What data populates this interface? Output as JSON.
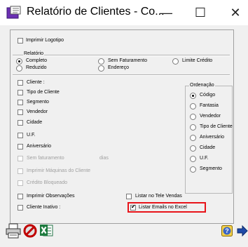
{
  "window": {
    "title": "Relatório de Clientes - Co...",
    "minimize": "—",
    "maximize": "☐",
    "close": "✕"
  },
  "options": {
    "imprimir_logotipo": "Imprimir Logotipo"
  },
  "relatorio": {
    "legend": "Relatório",
    "completo": "Completo",
    "reduzido": "Reduzido",
    "sem_faturamento": "Sem Faturamento",
    "endereco": "Endereço",
    "limite_credito": "Limite Crédito"
  },
  "filters": {
    "cliente": "Cliente :",
    "tipo_cliente": "Tipo de Cliente",
    "segmento": "Segmento",
    "vendedor": "Vendedor",
    "cidade": "Cidade",
    "uf": "U.F.",
    "aniversario": "Aniversário",
    "sem_faturamento": "Sem faturamento",
    "dias": "dias",
    "imprimir_maquinas": "Imprimir Máquinas do Cliente",
    "credito_bloqueado": "Crédito Bloqueado",
    "imprimir_observacoes": "Imprimir Observações",
    "cliente_inativo": "Cliente Inativo :",
    "listar_tele_vendas": "Listar no Tele Vendas",
    "listar_emails_excel": "Listar Emails no Excel"
  },
  "ordenacao": {
    "legend": "Ordenação",
    "codigo": "Código",
    "fantasia": "Fantasia",
    "vendedor": "Vendedor",
    "tipo_cliente": "Tipo de Cliente",
    "aniversario": "Aniversário",
    "cidade": "Cidade",
    "uf": "U.F.",
    "segmento": "Segmento"
  }
}
